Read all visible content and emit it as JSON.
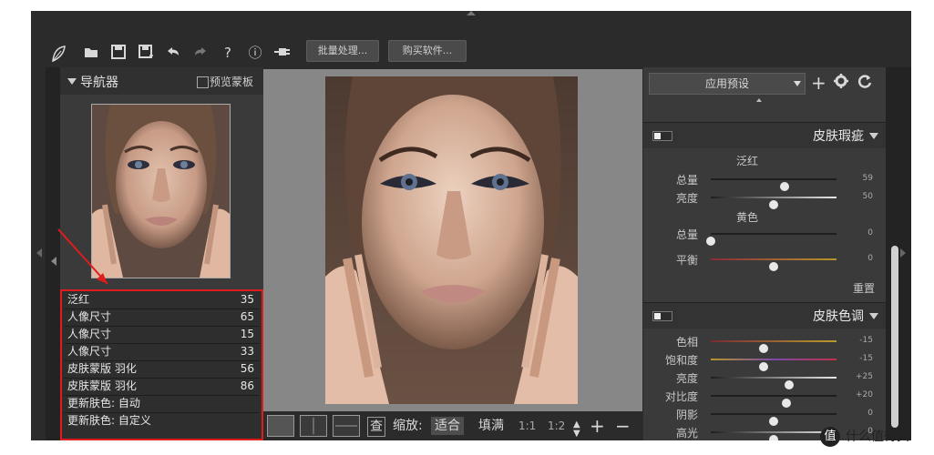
{
  "toolbar": {
    "icons": [
      "feather-logo-icon",
      "open-folder-icon",
      "save-icon",
      "save-as-icon",
      "undo-icon",
      "redo-icon",
      "help-icon",
      "info-icon",
      "plugin-icon"
    ],
    "help_glyph": "?",
    "info_glyph": "ⓘ",
    "batch_label": "批量处理...",
    "buy_label": "购买软件..."
  },
  "navigator": {
    "title": "导航器",
    "preview_label": "预览蒙板"
  },
  "history": [
    {
      "name": "泛红",
      "value": "35"
    },
    {
      "name": "人像尺寸",
      "value": "65"
    },
    {
      "name": "人像尺寸",
      "value": "15"
    },
    {
      "name": "人像尺寸",
      "value": "33"
    },
    {
      "name": "皮肤蒙版 羽化",
      "value": "56"
    },
    {
      "name": "皮肤蒙版 羽化",
      "value": "86"
    },
    {
      "name": "更新肤色: 自动",
      "value": ""
    },
    {
      "name": "更新肤色: 自定义",
      "value": ""
    }
  ],
  "bottom_bar": {
    "zoom_label": "缩放:",
    "fit_label": "适合",
    "fill_label": "填满",
    "ratio_1": "1:1",
    "ratio_2": "1:2",
    "plus": "+",
    "minus": "−",
    "compare_glyph": "查"
  },
  "right_panel": {
    "preset_label": "应用预设",
    "section1": {
      "title": "皮肤瑕疵",
      "group1": "泛红",
      "group2": "黄色",
      "sliders": [
        {
          "label": "总量",
          "value": "59",
          "level": 0.59
        },
        {
          "label": "亮度",
          "value": "50",
          "level": 0.5
        },
        {
          "label": "总量",
          "value": "0",
          "level": 0.0
        },
        {
          "label": "平衡",
          "value": "0",
          "level": 0.5
        }
      ],
      "reset_label": "重置"
    },
    "section2": {
      "title": "皮肤色调",
      "sliders": [
        {
          "label": "色相",
          "value": "-15",
          "level": 0.42
        },
        {
          "label": "饱和度",
          "value": "-15",
          "level": 0.42
        },
        {
          "label": "亮度",
          "value": "+25",
          "level": 0.62
        },
        {
          "label": "对比度",
          "value": "+20",
          "level": 0.6
        },
        {
          "label": "阴影",
          "value": "0",
          "level": 0.5
        },
        {
          "label": "高光",
          "value": "0",
          "level": 0.5
        }
      ]
    }
  },
  "watermark": {
    "logo": "值",
    "text": "什么值得买"
  },
  "colors": {
    "highlight_border": "#e01c1c",
    "app_background": "#2b2b2b",
    "canvas_background": "#878787"
  }
}
